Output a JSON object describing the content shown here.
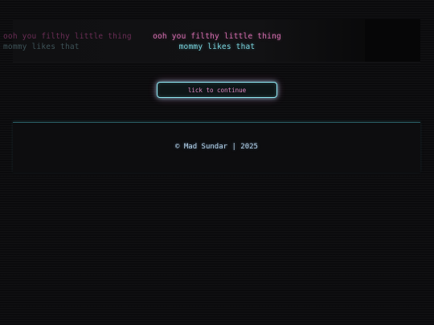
{
  "banner": {
    "ghost_line_1": "ooh you filthy little thing",
    "ghost_line_2": "mommy likes that",
    "line_1": "ooh you filthy little thing",
    "line_2": "mommy likes that"
  },
  "continue_button": {
    "label": "lick to continue"
  },
  "footer": {
    "copyright": "© Mad Sundar | 2025"
  },
  "colors": {
    "pink": "#d86fb2",
    "cyan": "#7ad6e0",
    "background": "#0b0b0d"
  }
}
